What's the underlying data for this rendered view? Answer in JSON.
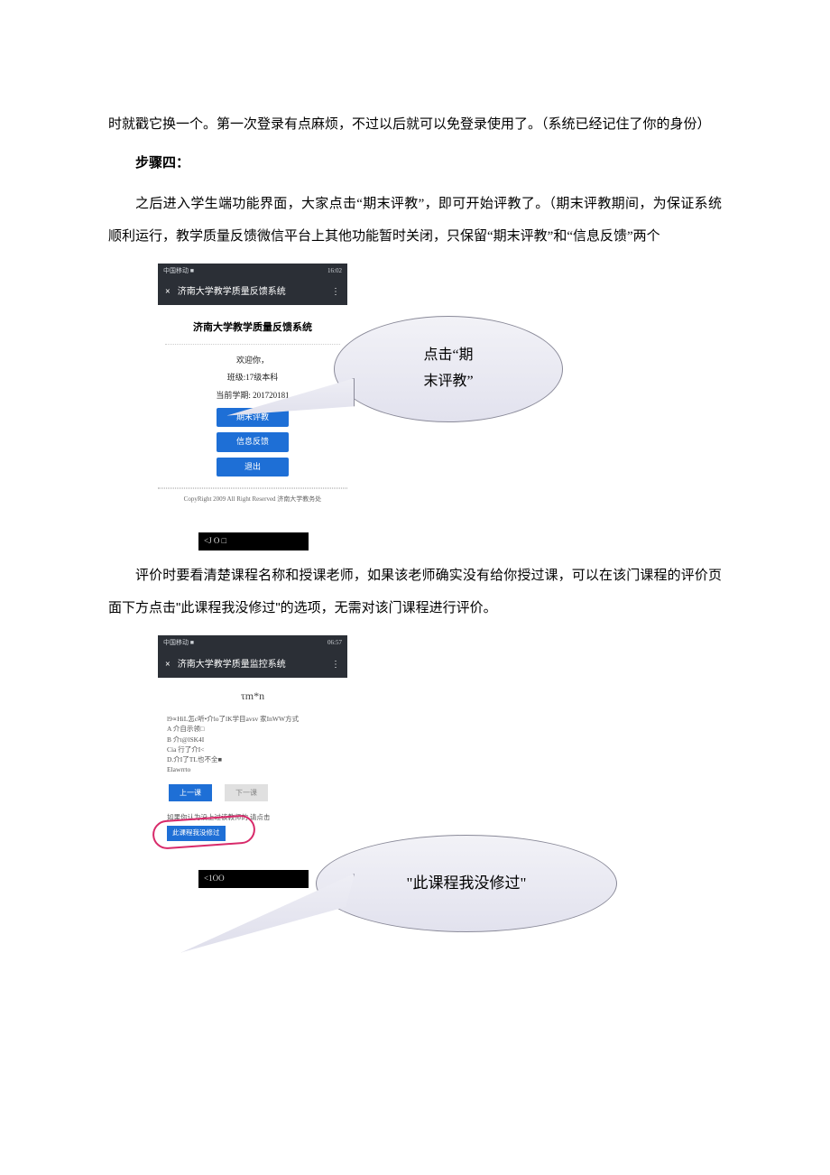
{
  "intro_paragraph": "时就戳它换一个。第一次登录有点麻烦，不过以后就可以免登录使用了。（系统已经记住了你的身份）",
  "step_heading": "步骤四：",
  "step4_paragraph": "之后进入学生端功能界面，大家点击“期末评教”，即可开始评教了。（期末评教期间，为保证系统顺利运行，教学质量反馈微信平台上其他功能暂时关闭，只保留“期末评教”和“信息反馈”两个",
  "callout1_line1": "点击“期",
  "callout1_line2": "末评教”",
  "phone1": {
    "status_left": "中国移动 ■",
    "status_right": "16:02",
    "titlebar_x": "×",
    "titlebar_text": "济南大学教学质量反馈系统",
    "titlebar_more": "⋮",
    "big_title": "济南大学教学质量反馈系统",
    "welcome": "欢迎你，",
    "class_line": "班级:17级本科",
    "term_line": "当前学期: 201720181",
    "btn1": "期末评教",
    "btn2": "信息反馈",
    "btn3": "退出",
    "copyright": "CopyRight 2009 All Right Reserved 济南大学教务处"
  },
  "blackbar1": "<J O □",
  "middle_paragraph": "评价时要看清楚课程名称和授课老师，如果该老师确实没有给你授过课，可以在该门课程的评价页面下方点击\"此课程我没修过\"的选项，无需对该门课程进行评价。",
  "phone2": {
    "status_left": "中国移动 ■",
    "status_right": "06:57",
    "titlebar_x": "×",
    "titlebar_text": "济南大学教学质量监控系统",
    "titlebar_more": "⋮",
    "tau": "τm*n",
    "q_intro": "l9∝HiL怎c听•介lo了lK学目avsv 家InWW方式",
    "optA": "A 介自示领□",
    "optB": "B 介t@lSK4I",
    "optC": "Cia 行了介I<",
    "optD": "D.介I了TL也不全■",
    "optE": "Elawrrto",
    "prev": "上一课",
    "next": "下一课",
    "hint_prefix": "如果你认为没上过该教师的",
    "hint_suffix": "请点击",
    "not_taken_btn": "此课程我没修过"
  },
  "callout2_text": "\"此课程我没修过\"",
  "blackbar2": "<1OO"
}
